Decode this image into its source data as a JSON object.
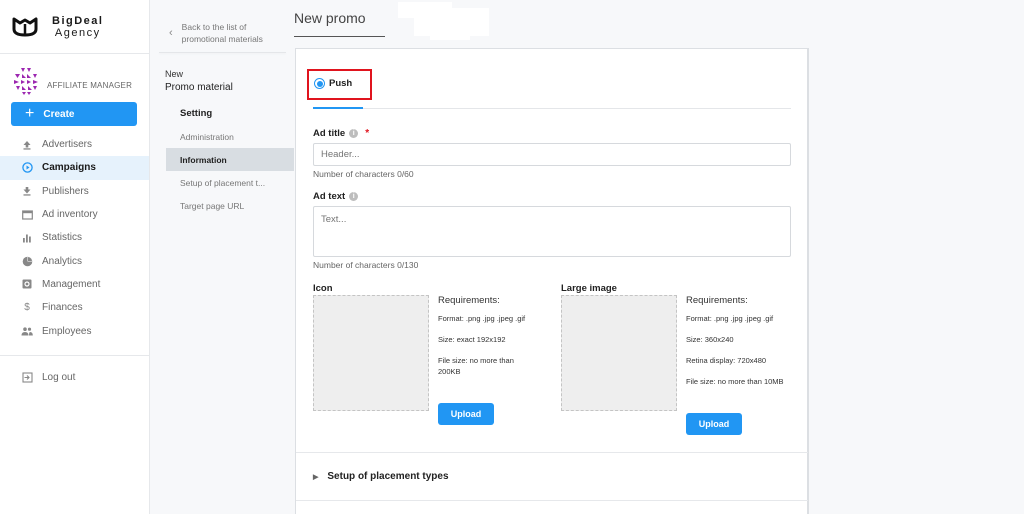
{
  "brand": {
    "name": "BigDeal",
    "subname": "Agency"
  },
  "role": {
    "label": "AFFILIATE MANAGER"
  },
  "sidebar": {
    "create_label": "Create",
    "items": [
      {
        "label": "Advertisers",
        "icon": "upload-icon",
        "active": false
      },
      {
        "label": "Campaigns",
        "icon": "play-circle-icon",
        "active": true
      },
      {
        "label": "Publishers",
        "icon": "download-icon",
        "active": false
      },
      {
        "label": "Ad inventory",
        "icon": "window-icon",
        "active": false
      },
      {
        "label": "Statistics",
        "icon": "bar-chart-icon",
        "active": false
      },
      {
        "label": "Analytics",
        "icon": "pie-chart-icon",
        "active": false
      },
      {
        "label": "Management",
        "icon": "settings-box-icon",
        "active": false
      },
      {
        "label": "Finances",
        "icon": "dollar-icon",
        "active": false
      },
      {
        "label": "Employees",
        "icon": "people-icon",
        "active": false
      }
    ],
    "logout_label": "Log out"
  },
  "subpanel": {
    "back_line1": "Back to the list of",
    "back_line2": "promotional materials",
    "title_small": "New",
    "title_big": "Promo material",
    "items": [
      {
        "label": "Setting",
        "type": "head"
      },
      {
        "label": "Administration",
        "type": "item"
      },
      {
        "label": "Information",
        "type": "active"
      },
      {
        "label": "Setup of placement t...",
        "type": "item"
      },
      {
        "label": "Target page URL",
        "type": "item"
      }
    ]
  },
  "main": {
    "page_title": "New promo",
    "tab_label": "Push",
    "ad_title": {
      "label": "Ad title",
      "required_mark": "*",
      "placeholder": "Header...",
      "value": "",
      "hint": "Number of characters 0/60"
    },
    "ad_text": {
      "label": "Ad text",
      "placeholder": "Text...",
      "value": "",
      "hint": "Number of characters 0/130"
    },
    "icon_upload": {
      "title": "Icon",
      "req_heading": "Requirements:",
      "reqs": [
        "Format: .png .jpg .jpeg .gif",
        "Size: exact 192x192",
        "File size: no more than 200KB"
      ],
      "button": "Upload"
    },
    "large_upload": {
      "title": "Large image",
      "req_heading": "Requirements:",
      "reqs": [
        "Format: .png .jpg .jpeg .gif",
        "Size: 360x240",
        "Retina display: 720x480",
        "File size: no more than 10MB"
      ],
      "button": "Upload"
    },
    "section_placement": "Setup of placement types"
  },
  "colors": {
    "accent": "#2196f3",
    "highlight_box": "#e0141e",
    "active_nav_bg": "#e6f2fc",
    "active_sub_bg": "#d8dde2"
  }
}
